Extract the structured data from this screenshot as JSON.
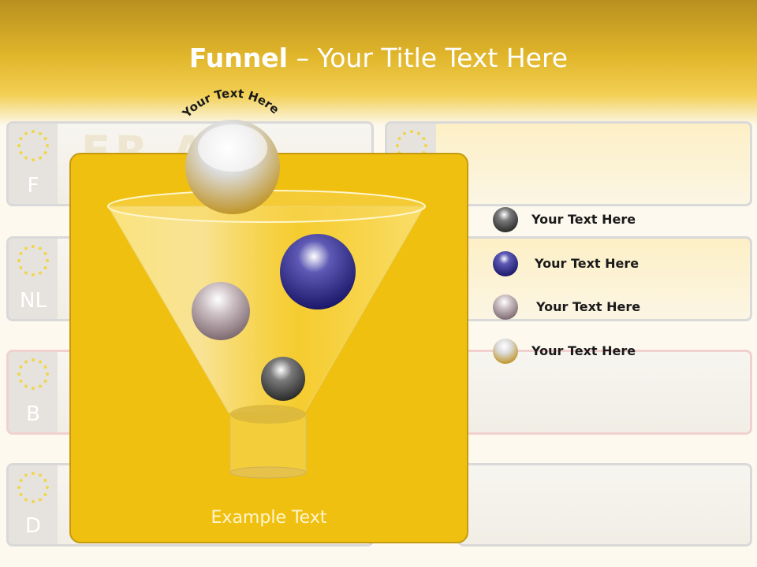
{
  "title": {
    "bold": "Funnel",
    "dash": " – ",
    "rest": "Your Title Text Here"
  },
  "arc_text": "Your Text Here",
  "example_text": "Example Text",
  "plates": [
    {
      "letter": "F",
      "ghost": "FR   AA"
    },
    {
      "letter": "NL"
    },
    {
      "letter": "B"
    },
    {
      "letter": "D"
    }
  ],
  "legend": [
    {
      "label": "Your  Text Here",
      "color": "#3f3f3f"
    },
    {
      "label": "Your  Text Here",
      "color": "#27237a"
    },
    {
      "label": "Your  Text Here",
      "color": "#9c8a8f"
    },
    {
      "label": "Your  Text Here",
      "color": "#c89a2a"
    }
  ],
  "colors": {
    "header": "#e1b62b",
    "panel": "#f0c010",
    "funnel_glass": "#ffe98a"
  }
}
